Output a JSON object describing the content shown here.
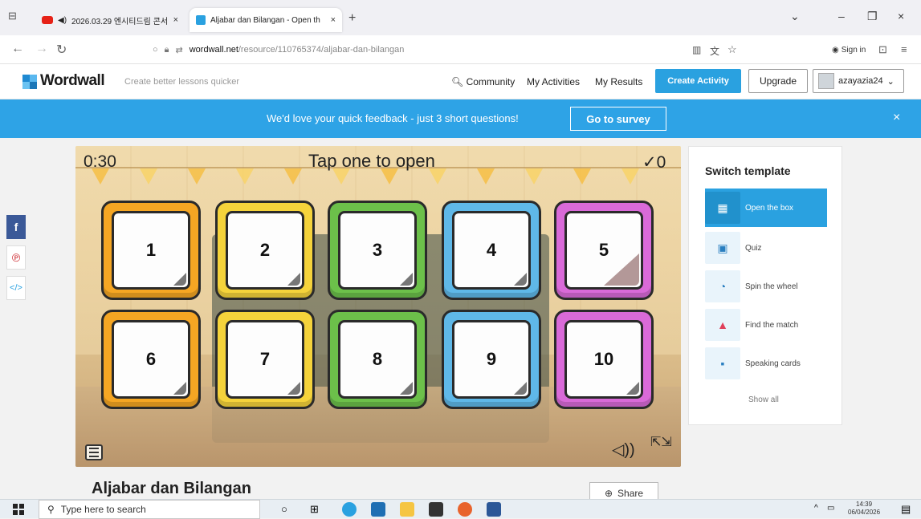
{
  "browser": {
    "tabs": [
      {
        "label": "2026.03.29 엔시티드림 콘서",
        "active": false
      },
      {
        "label": "Aljabar dan Bilangan - Open th",
        "active": true
      }
    ],
    "new_tab": "+",
    "url_host": "wordwall.net",
    "url_path": "/resource/110765374/aljabar-dan-bilangan",
    "sign_in": "Sign in"
  },
  "header": {
    "logo": "Wordwall",
    "tagline": "Create better lessons quicker",
    "nav": [
      "Community",
      "My Activities",
      "My Results"
    ],
    "create": "Create Activity",
    "upgrade": "Upgrade",
    "user": "azayazia24"
  },
  "banner": {
    "text": "We'd love your quick feedback - just 3 short questions!",
    "button": "Go to survey",
    "close": "×"
  },
  "game": {
    "timer": "0:30",
    "instruction": "Tap one to open",
    "score": "✓0",
    "boxes": [
      "1",
      "2",
      "3",
      "4",
      "5",
      "6",
      "7",
      "8",
      "9",
      "10"
    ],
    "box_colors": [
      "#f5a623",
      "#f5d33b",
      "#6cc04a",
      "#5fb8e8",
      "#d96ad8",
      "#f5a623",
      "#f5d33b",
      "#6cc04a",
      "#5fb8e8",
      "#d96ad8"
    ]
  },
  "templates": {
    "title": "Switch template",
    "items": [
      "Open the box",
      "Quiz",
      "Spin the wheel",
      "Find the match",
      "Speaking cards"
    ],
    "show_all": "Show all"
  },
  "activity": {
    "title": "Aljabar dan Bilangan",
    "share": "Share"
  },
  "taskbar": {
    "search_placeholder": "Type here to search",
    "time": "14:39",
    "date": "06/04/2026"
  },
  "colors": {
    "accent": "#2aa1e0",
    "banner": "#2ea3e6"
  }
}
